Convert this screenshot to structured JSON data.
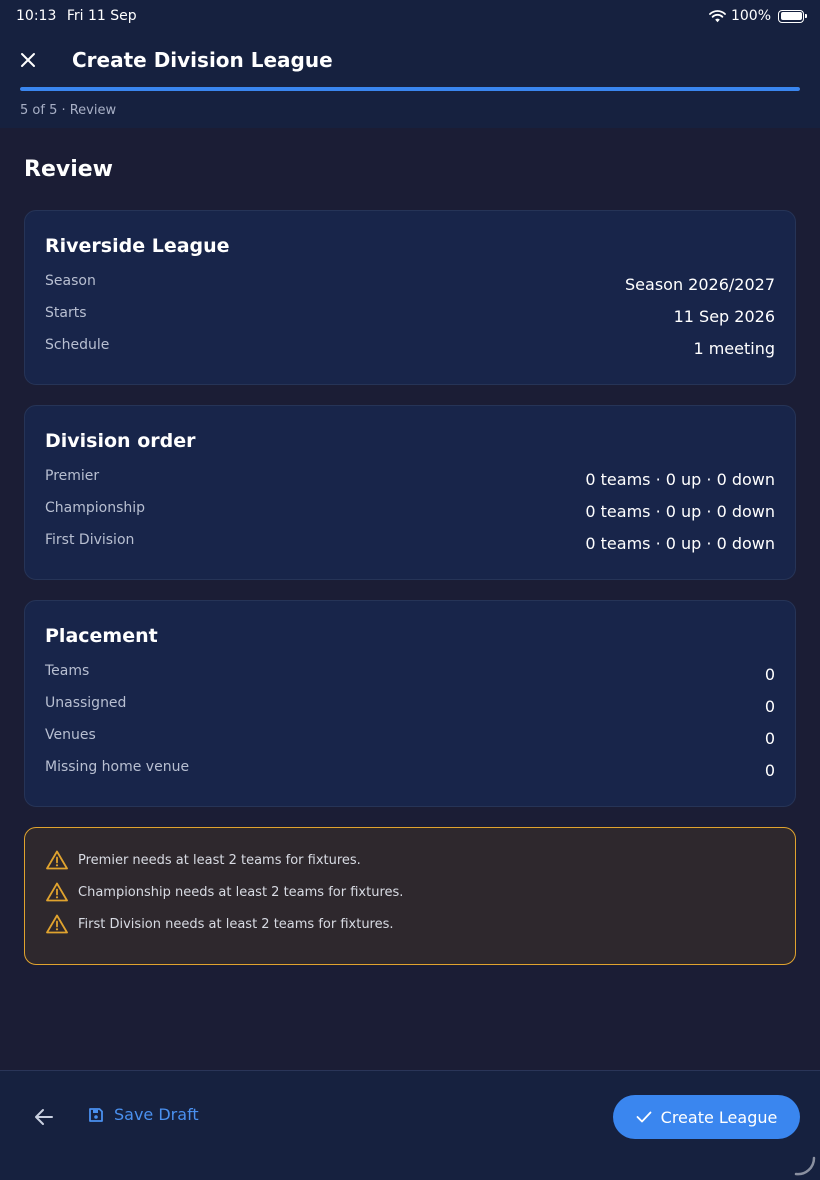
{
  "status_bar": {
    "time": "10:13",
    "date": "Fri 11 Sep",
    "battery": "100%"
  },
  "header": {
    "title": "Create Division League",
    "step_label": "5 of 5 · Review",
    "progress": 1.0
  },
  "review": {
    "heading": "Review",
    "league_card": {
      "title": "Riverside League",
      "rows": [
        {
          "label": "Season",
          "value": "Season 2026/2027"
        },
        {
          "label": "Starts",
          "value": "11 Sep 2026"
        },
        {
          "label": "Schedule",
          "value": "1 meeting"
        }
      ]
    },
    "division_card": {
      "title": "Division order",
      "rows": [
        {
          "label": "Premier",
          "value": "0 teams · 0 up · 0 down"
        },
        {
          "label": "Championship",
          "value": "0 teams · 0 up · 0 down"
        },
        {
          "label": "First Division",
          "value": "0 teams · 0 up · 0 down"
        }
      ]
    },
    "placement_card": {
      "title": "Placement",
      "rows": [
        {
          "label": "Teams",
          "value": "0"
        },
        {
          "label": "Unassigned",
          "value": "0"
        },
        {
          "label": "Venues",
          "value": "0"
        },
        {
          "label": "Missing home venue",
          "value": "0"
        }
      ]
    },
    "warnings": [
      "Premier needs at least 2 teams for fixtures.",
      "Championship needs at least 2 teams for fixtures.",
      "First Division needs at least 2 teams for fixtures."
    ]
  },
  "footer": {
    "save_draft": "Save Draft",
    "create": "Create League"
  },
  "colors": {
    "accent": "#3a86ef",
    "warning": "#e0a32e",
    "card": "#18254a",
    "background": "#1b1d35"
  },
  "icons": {
    "close": "close-icon",
    "back": "arrow-left-icon",
    "save": "floppy-disk-icon",
    "confirm": "check-icon",
    "warning": "warning-triangle-icon"
  }
}
